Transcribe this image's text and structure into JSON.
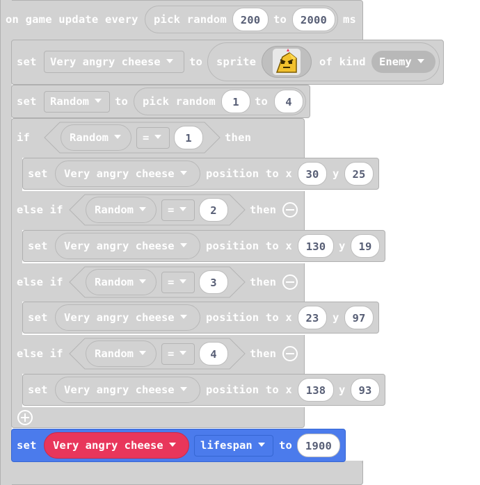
{
  "event": {
    "label": "on game update every",
    "pick": "pick random",
    "min": "200",
    "to": "to",
    "max": "2000",
    "unit": "ms"
  },
  "create": {
    "set": "set",
    "var": "Very angry cheese",
    "to": "to",
    "sprite": "sprite",
    "of_kind": "of kind",
    "kind": "Enemy"
  },
  "random": {
    "set": "set",
    "var": "Random",
    "to": "to",
    "pick": "pick random",
    "min": "1",
    "to2": "to",
    "max": "4"
  },
  "conditions": [
    {
      "kw": "if",
      "var": "Random",
      "op": "=",
      "val": "1",
      "then": "then",
      "pos": {
        "set": "set",
        "var": "Very angry cheese",
        "label": "position to x",
        "x": "30",
        "y_label": "y",
        "y": "25"
      }
    },
    {
      "kw": "else if",
      "var": "Random",
      "op": "=",
      "val": "2",
      "then": "then",
      "pos": {
        "set": "set",
        "var": "Very angry cheese",
        "label": "position to x",
        "x": "130",
        "y_label": "y",
        "y": "19"
      }
    },
    {
      "kw": "else if",
      "var": "Random",
      "op": "=",
      "val": "3",
      "then": "then",
      "pos": {
        "set": "set",
        "var": "Very angry cheese",
        "label": "position to x",
        "x": "23",
        "y_label": "y",
        "y": "97"
      }
    },
    {
      "kw": "else if",
      "var": "Random",
      "op": "=",
      "val": "4",
      "then": "then",
      "pos": {
        "set": "set",
        "var": "Very angry cheese",
        "label": "position to x",
        "x": "138",
        "y_label": "y",
        "y": "93"
      }
    }
  ],
  "lifespan": {
    "set": "set",
    "var": "Very angry cheese",
    "prop": "lifespan",
    "to": "to",
    "val": "1900"
  },
  "colors": {
    "block": "#d2d2d2",
    "number_bg": "#ffffff",
    "number_text": "#575e75",
    "sprites_blue": "#4b7bec",
    "variable_red": "#e8365b"
  }
}
